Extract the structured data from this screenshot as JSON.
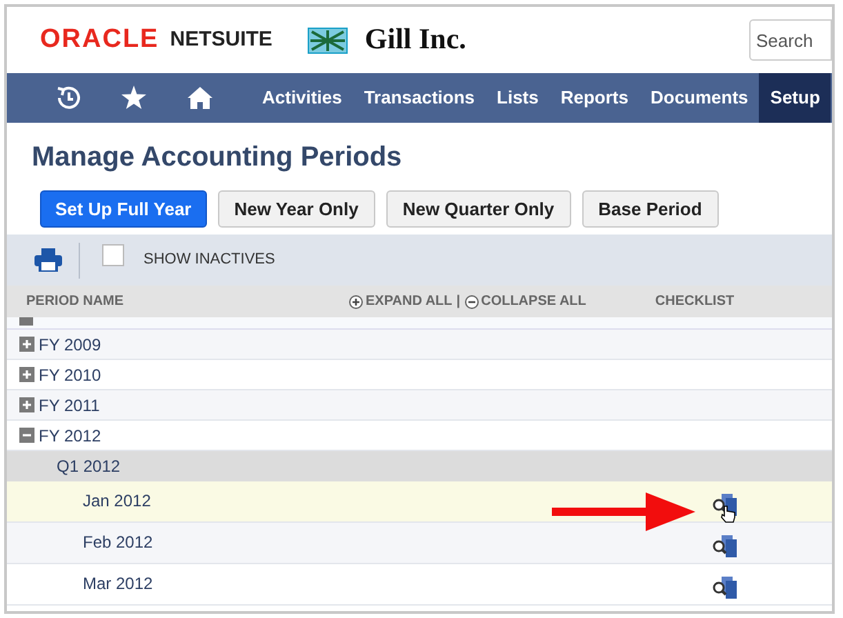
{
  "header": {
    "brand": "NETSUITE",
    "oracle": "ORACLE",
    "company": "Gill Inc.",
    "search": {
      "placeholder": "Search"
    }
  },
  "nav": {
    "items": [
      {
        "kind": "recent",
        "selected": false
      },
      {
        "kind": "star",
        "selected": false
      },
      {
        "kind": "home",
        "selected": false
      },
      {
        "kind": "text",
        "label": "Activities",
        "selected": false
      },
      {
        "kind": "text",
        "label": "Transactions",
        "selected": false
      },
      {
        "kind": "text",
        "label": "Lists",
        "selected": false
      },
      {
        "kind": "text",
        "label": "Reports",
        "selected": false
      },
      {
        "kind": "text",
        "label": "Documents",
        "selected": false
      },
      {
        "kind": "text",
        "label": "Setup",
        "selected": true
      }
    ]
  },
  "page_title": "Manage Accounting Periods",
  "buttons": [
    {
      "label": "Set Up Full Year",
      "primary": true
    },
    {
      "label": "New Year Only",
      "primary": false
    },
    {
      "label": "New Quarter Only",
      "primary": false
    },
    {
      "label": "Base Period",
      "primary": false
    }
  ],
  "toolbar": {
    "show_inactives": {
      "label": "SHOW INACTIVES",
      "checked": false
    }
  },
  "table": {
    "columns": {
      "period_name": "PERIOD NAME",
      "expand_all": "EXPAND ALL",
      "separator": "|",
      "collapse_all": "COLLAPSE ALL",
      "checklist": "CHECKLIST"
    },
    "rows": [
      {
        "kind": "year",
        "label": "FY 2009",
        "expanded": false
      },
      {
        "kind": "year",
        "label": "FY 2010",
        "expanded": false
      },
      {
        "kind": "year",
        "label": "FY 2011",
        "expanded": false
      },
      {
        "kind": "year",
        "label": "FY 2012",
        "expanded": true,
        "children": [
          {
            "kind": "quarter",
            "label": "Q1 2012",
            "children": [
              {
                "kind": "month",
                "label": "Jan 2012",
                "highlighted": true
              },
              {
                "kind": "month",
                "label": "Feb 2012",
                "highlighted": false
              },
              {
                "kind": "month",
                "label": "Mar 2012",
                "highlighted": false
              }
            ]
          }
        ]
      }
    ]
  }
}
